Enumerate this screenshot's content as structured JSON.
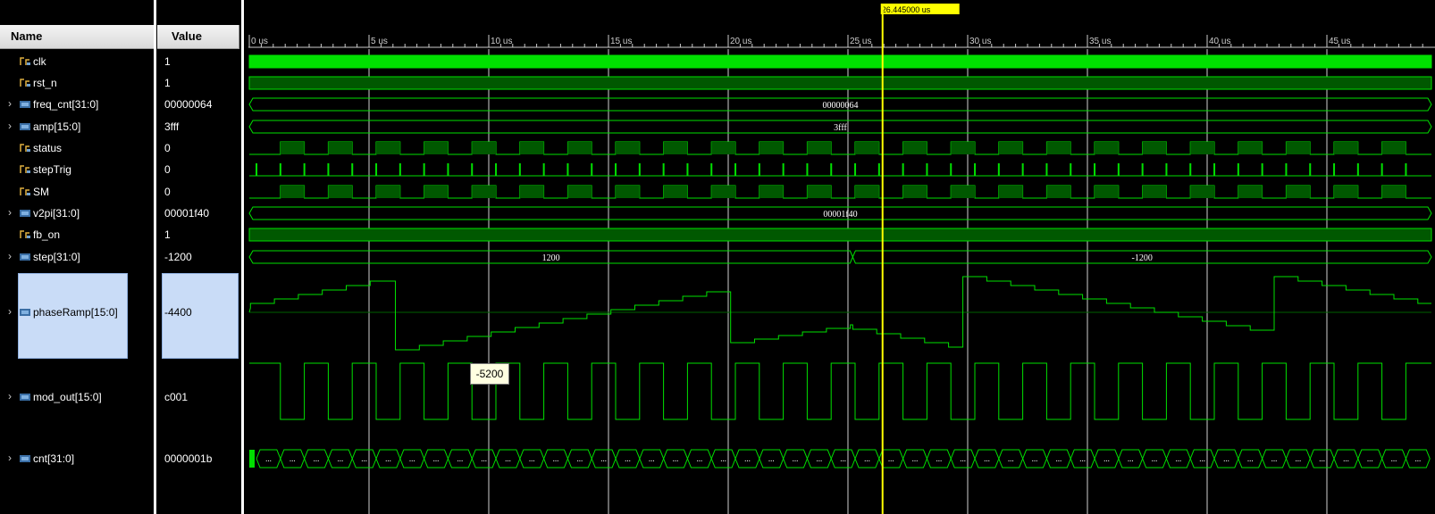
{
  "columns": {
    "name": "Name",
    "value": "Value"
  },
  "cursor": {
    "label": "26.445000 us",
    "time_us": 26.445
  },
  "time_axis": {
    "ticks_us": [
      0,
      5,
      10,
      15,
      20,
      25,
      30,
      35,
      40,
      45
    ],
    "unit": "us",
    "max_us": 49.3
  },
  "signals": [
    {
      "name": "clk",
      "value": "1",
      "bus": false
    },
    {
      "name": "rst_n",
      "value": "1",
      "bus": false
    },
    {
      "name": "freq_cnt[31:0]",
      "value": "00000064",
      "bus": true,
      "wave_label": "00000064"
    },
    {
      "name": "amp[15:0]",
      "value": "3fff",
      "bus": true,
      "wave_label": "3fff"
    },
    {
      "name": "status",
      "value": "0",
      "bus": false
    },
    {
      "name": "stepTrig",
      "value": "0",
      "bus": false
    },
    {
      "name": "SM",
      "value": "0",
      "bus": false
    },
    {
      "name": "v2pi[31:0]",
      "value": "00001f40",
      "bus": true,
      "wave_label": "00001f40"
    },
    {
      "name": "fb_on",
      "value": "1",
      "bus": false
    },
    {
      "name": "step[31:0]",
      "value": "-1200",
      "bus": true,
      "wave_labels": [
        "1200",
        "-1200"
      ],
      "transition_us": 25.2
    },
    {
      "name": "phaseRamp[15:0]",
      "value": "-4400",
      "bus": true,
      "analog": true,
      "selected": true
    },
    {
      "name": "mod_out[15:0]",
      "value": "c001",
      "bus": true,
      "analog": true
    },
    {
      "name": "cnt[31:0]",
      "value": "0000001b",
      "bus": true,
      "wave_label": "..."
    }
  ],
  "tooltip": {
    "text": "-5200"
  },
  "colors": {
    "wave": "#00e000",
    "cursor": "#ffff00",
    "grid": "#ffffff",
    "selection": "#c9dcf7"
  }
}
